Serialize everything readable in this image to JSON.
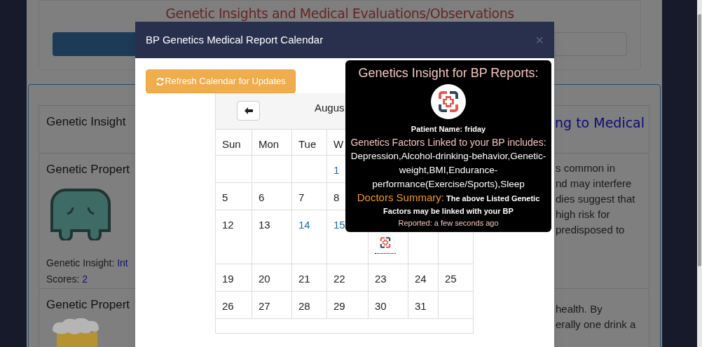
{
  "background_page": {
    "heading": "Genetic Insights and Medical Evaluations/Observations",
    "table_headers": [
      "Genetic Insight",
      "ng to Medical"
    ],
    "rows": [
      {
        "title": "Genetic Propert",
        "insight_label": "Genetic Insight: ",
        "insight_value": "Int",
        "scores_label": "Scores: ",
        "scores_value": "2",
        "text_lines": [
          "s common in",
          "nd may interfere",
          "dies suggest that",
          "high risk for",
          "predisposed to"
        ]
      },
      {
        "title": "Genetic Propert",
        "text_lines": [
          "health. By",
          "erally one drink a"
        ]
      }
    ]
  },
  "modal": {
    "title": "BP Genetics Medical Report Calendar",
    "close": "×",
    "refresh_button": "Refresh Calendar for Updates",
    "calendar": {
      "month": "Augus",
      "weekdays": [
        "Sun",
        "Mon",
        "Tue",
        "W"
      ],
      "weeks": [
        [
          {
            "kind": "empty"
          },
          {
            "kind": "empty"
          },
          {
            "kind": "empty"
          },
          {
            "kind": "day",
            "label": "1",
            "linked": true
          }
        ],
        [
          {
            "kind": "day",
            "label": "5",
            "linked": false
          },
          {
            "kind": "day",
            "label": "6",
            "linked": false
          },
          {
            "kind": "day",
            "label": "7",
            "linked": false
          },
          {
            "kind": "day",
            "label": "8",
            "linked": false
          }
        ],
        [
          {
            "kind": "day",
            "label": "12",
            "linked": false
          },
          {
            "kind": "day",
            "label": "13",
            "linked": false
          },
          {
            "kind": "day",
            "label": "14",
            "linked": true
          },
          {
            "kind": "day",
            "label": "15",
            "linked": true
          },
          {
            "kind": "event"
          }
        ],
        [
          {
            "kind": "day",
            "label": "19",
            "linked": false
          },
          {
            "kind": "day",
            "label": "20",
            "linked": false
          },
          {
            "kind": "day",
            "label": "21",
            "linked": false
          },
          {
            "kind": "day",
            "label": "22",
            "linked": false
          },
          {
            "kind": "day",
            "label": "23",
            "linked": false
          },
          {
            "kind": "day",
            "label": "24",
            "linked": false
          },
          {
            "kind": "day",
            "label": "25",
            "linked": false
          }
        ],
        [
          {
            "kind": "day",
            "label": "26",
            "linked": false
          },
          {
            "kind": "day",
            "label": "27",
            "linked": false
          },
          {
            "kind": "day",
            "label": "28",
            "linked": false
          },
          {
            "kind": "day",
            "label": "29",
            "linked": false
          },
          {
            "kind": "day",
            "label": "30",
            "linked": false
          },
          {
            "kind": "day",
            "label": "31",
            "linked": false
          }
        ]
      ]
    }
  },
  "tooltip": {
    "title": "Genetics Insight for BP Reports:",
    "patient": "Patient Name: friday",
    "factors_heading": "Genetics Factors Linked to your BP includes:",
    "factors": "Depression,Alcohol-drinking-behavior,Genetic-weight,BMI,Endurance-performance(Exercise/Sports),Sleep",
    "summary_label": "Doctors Summary:",
    "summary_text": "The above Listed Genetic Factors may be linked with your BP",
    "reported": "Reported: a few seconds ago"
  }
}
